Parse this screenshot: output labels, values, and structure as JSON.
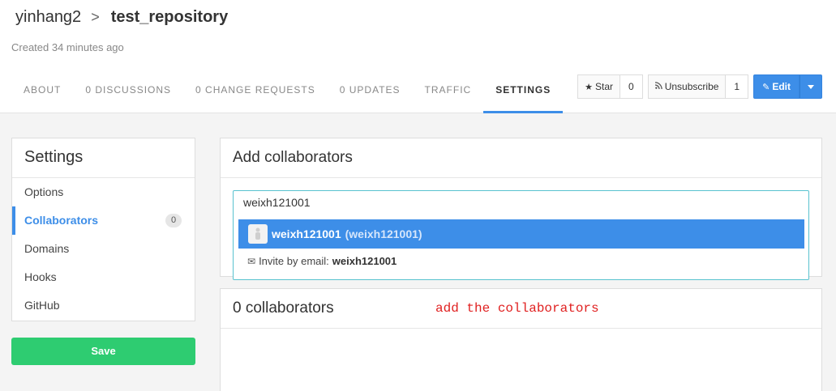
{
  "header": {
    "owner": "yinhang2",
    "separator": ">",
    "repo": "test_repository",
    "created": "Created 34 minutes ago"
  },
  "tabs": [
    {
      "label": "ABOUT"
    },
    {
      "label": "0 DISCUSSIONS"
    },
    {
      "label": "0 CHANGE REQUESTS"
    },
    {
      "label": "0 UPDATES"
    },
    {
      "label": "TRAFFIC"
    },
    {
      "label": "SETTINGS"
    }
  ],
  "actions": {
    "star_label": "Star",
    "star_count": "0",
    "unsubscribe_label": "Unsubscribe",
    "unsubscribe_count": "1",
    "edit_label": "Edit"
  },
  "sidebar": {
    "title": "Settings",
    "items": [
      {
        "label": "Options"
      },
      {
        "label": "Collaborators",
        "badge": "0"
      },
      {
        "label": "Domains"
      },
      {
        "label": "Hooks"
      },
      {
        "label": "GitHub"
      }
    ],
    "save_label": "Save"
  },
  "add_panel": {
    "title": "Add collaborators",
    "search_value": "weixh121001",
    "suggestion_user": "weixh121001",
    "suggestion_full": "(weixh121001)",
    "invite_label": "Invite by email:",
    "invite_email": "weixh121001"
  },
  "list_panel": {
    "title": "0 collaborators"
  },
  "annotation": "add the collaborators",
  "colors": {
    "accent": "#3d8ee8",
    "save": "#2ecc71",
    "annotation": "#e02020"
  }
}
